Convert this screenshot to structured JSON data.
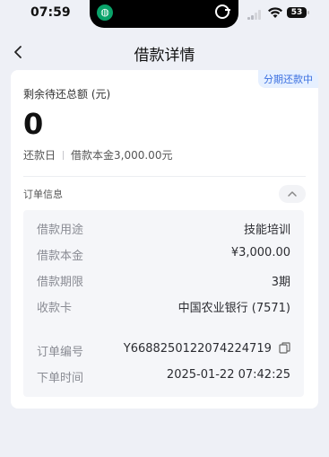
{
  "status": {
    "time": "07:59",
    "battery": "53"
  },
  "nav": {
    "title": "借款详情"
  },
  "summary": {
    "tag": "分期还款中",
    "remain_label": "剩余待还总额 (元)",
    "remain_amount": "0",
    "due_label": "还款日",
    "principal_text": "借款本金3,000.00元"
  },
  "order": {
    "title": "订单信息",
    "rows": [
      {
        "label": "借款用途",
        "value": "技能培训"
      },
      {
        "label": "借款本金",
        "value": "¥3,000.00"
      },
      {
        "label": "借款期限",
        "value": "3期"
      },
      {
        "label": "收款卡",
        "value": "中国农业银行 (7571)"
      },
      {
        "label": "订单编号",
        "value": "Y6688250122074224719"
      },
      {
        "label": "下单时间",
        "value": "2025-01-22 07:42:25"
      }
    ]
  },
  "icons": [
    "back-icon",
    "chevron-up-icon",
    "copy-icon",
    "wifi-icon",
    "signal-icon",
    "battery-icon"
  ]
}
